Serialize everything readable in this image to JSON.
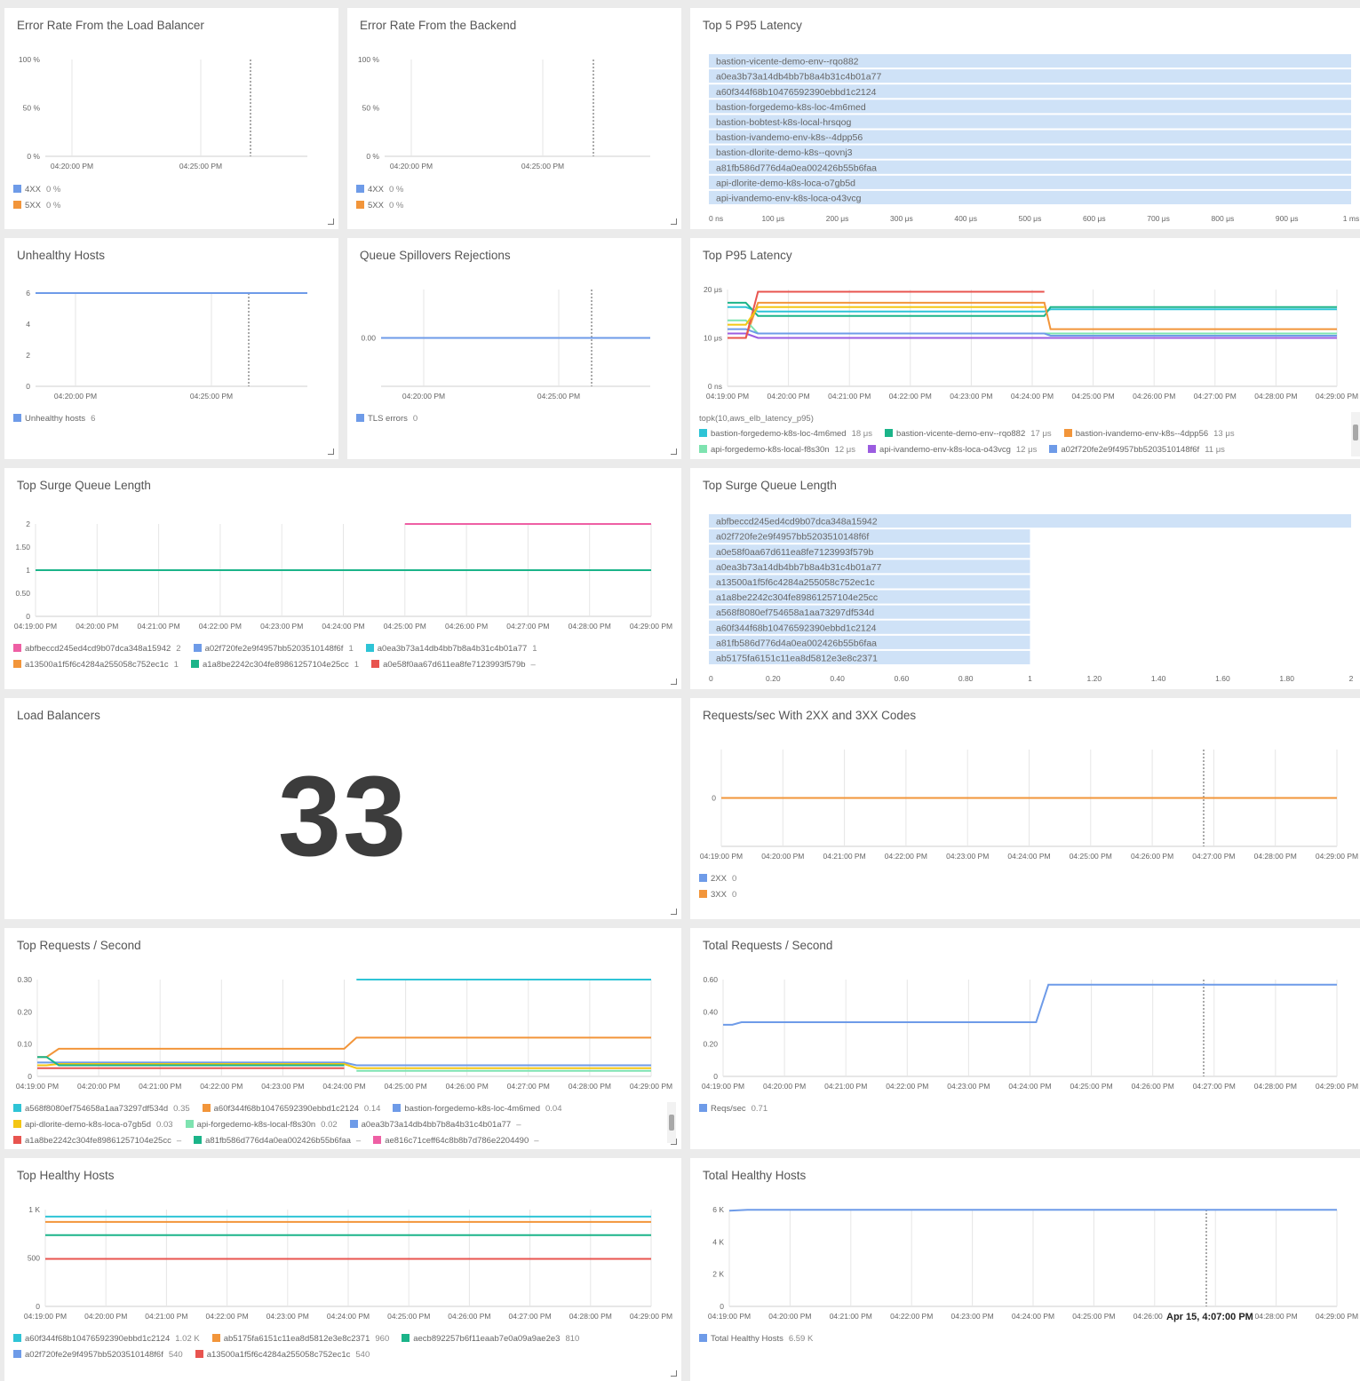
{
  "panels": {
    "p1": {
      "title": "Error Rate From the Load Balancer"
    },
    "p2": {
      "title": "Error Rate From the Backend"
    },
    "p3": {
      "title": "Top 5 P95 Latency"
    },
    "p4": {
      "title": "Unhealthy Hosts"
    },
    "p5": {
      "title": "Queue Spillovers Rejections"
    },
    "p6": {
      "title": "Top P95 Latency",
      "query": "topk(10,aws_elb_latency_p95)"
    },
    "p7": {
      "title": "Top Surge Queue Length"
    },
    "p8": {
      "title": "Top Surge Queue Length"
    },
    "p9": {
      "title": "Load Balancers",
      "value": "33"
    },
    "p10": {
      "title": "Requests/sec With 2XX and 3XX Codes"
    },
    "p11": {
      "title": "Top Requests / Second"
    },
    "p12": {
      "title": "Total Requests / Second"
    },
    "p13": {
      "title": "Top Healthy Hosts"
    },
    "p14": {
      "title": "Total Healthy Hosts",
      "tooltip": "Apr 15, 4:07:00 PM"
    }
  },
  "colors": {
    "blue": "#6e9be8",
    "orange": "#f2953a",
    "teal": "#2ec4d6",
    "green": "#1bb489",
    "red": "#e8544f",
    "purple": "#9b5ce0",
    "pink": "#ee5fa4",
    "lightgreen": "#7ee3b0",
    "yellow": "#f3c614",
    "grid": "#e6e6e6",
    "bar": "#cfe2f7"
  },
  "chart_data": [
    {
      "id": "p1",
      "type": "line",
      "ytick_labels": [
        "100 %",
        "50 %",
        "0 %"
      ],
      "xtick_labels": [
        "04:20:00 PM",
        "04:25:00 PM"
      ],
      "series": [
        {
          "name": "4XX",
          "color": "#6e9be8",
          "value": "0 %",
          "legend_value": "0 %"
        },
        {
          "name": "5XX",
          "color": "#f2953a",
          "value": "0 %",
          "legend_value": "0 %"
        }
      ]
    },
    {
      "id": "p2",
      "type": "line",
      "ytick_labels": [
        "100 %",
        "50 %",
        "0 %"
      ],
      "xtick_labels": [
        "04:20:00 PM",
        "04:25:00 PM"
      ],
      "series": [
        {
          "name": "4XX",
          "color": "#6e9be8",
          "legend_value": "0 %"
        },
        {
          "name": "5XX",
          "color": "#f2953a",
          "legend_value": "0 %"
        }
      ]
    },
    {
      "id": "p3",
      "type": "bar",
      "orientation": "horizontal",
      "unit": "μs",
      "categories": [
        "bastion-vicente-demo-env--rqo882",
        "a0ea3b73a14db4bb7b8a4b31c4b01a77",
        "a60f344f68b10476592390ebbd1c2124",
        "bastion-forgedemo-k8s-loc-4m6med",
        "bastion-bobtest-k8s-local-hrsqog",
        "bastion-ivandemo-env-k8s--4dpp56",
        "bastion-dlorite-demo-k8s--qovnj3",
        "a81fb586d776d4a0ea002426b55b6faa",
        "api-dlorite-demo-k8s-loca-o7gb5d",
        "api-ivandemo-env-k8s-loca-o43vcg"
      ],
      "values": [
        1000,
        1000,
        1000,
        1000,
        1000,
        1000,
        1000,
        1000,
        1000,
        1000
      ],
      "xlim": [
        0,
        1000
      ],
      "xtick_labels": [
        "0 ns",
        "100 μs",
        "200 μs",
        "300 μs",
        "400 μs",
        "500 μs",
        "600 μs",
        "700 μs",
        "800 μs",
        "900 μs",
        "1 ms"
      ]
    },
    {
      "id": "p4",
      "type": "line",
      "ylim": [
        0,
        6
      ],
      "ytick_labels": [
        "6",
        "4",
        "2",
        "0"
      ],
      "xtick_labels": [
        "04:20:00 PM",
        "04:25:00 PM"
      ],
      "series": [
        {
          "name": "Unhealthy hosts",
          "color": "#6e9be8",
          "values": [
            6,
            6
          ],
          "legend_value": "6"
        }
      ]
    },
    {
      "id": "p5",
      "type": "line",
      "ytick_labels": [
        "0.00"
      ],
      "xtick_labels": [
        "04:20:00 PM",
        "04:25:00 PM"
      ],
      "series": [
        {
          "name": "TLS errors",
          "color": "#6e9be8",
          "values": [
            0,
            0
          ],
          "legend_value": "0"
        }
      ]
    },
    {
      "id": "p6",
      "type": "line",
      "unit": "μs",
      "ylim": [
        0,
        22
      ],
      "ytick_labels": [
        "20 μs",
        "10 μs",
        "0 ns"
      ],
      "xtick_labels": [
        "04:19:00 PM",
        "04:20:00 PM",
        "04:21:00 PM",
        "04:22:00 PM",
        "04:23:00 PM",
        "04:24:00 PM",
        "04:25:00 PM",
        "04:26:00 PM",
        "04:27:00 PM",
        "04:28:00 PM",
        "04:29:00 PM"
      ],
      "x": [
        0,
        0.3,
        0.5,
        5.2,
        5.3,
        10
      ],
      "series": [
        {
          "name": "bastion-forgedemo-k8s-loc-4m6med",
          "color": "#2ec4d6",
          "legend_value": "18 μs",
          "values": [
            18,
            18,
            17,
            17,
            17.5,
            17.5
          ]
        },
        {
          "name": "bastion-vicente-demo-env--rqo882",
          "color": "#1bb489",
          "legend_value": "17 μs",
          "values": [
            19,
            19,
            16,
            16,
            18,
            18
          ]
        },
        {
          "name": "bastion-ivandemo-env-k8s--4dpp56",
          "color": "#f2953a",
          "legend_value": "13 μs",
          "values": [
            11,
            11,
            19,
            19,
            13,
            13
          ]
        },
        {
          "name": "api-forgedemo-k8s-local-f8s30n",
          "color": "#7ee3b0",
          "legend_value": "12 μs",
          "values": [
            15,
            15,
            12,
            12,
            12,
            12
          ]
        },
        {
          "name": "api-ivandemo-env-k8s-loca-o43vcg",
          "color": "#9b5ce0",
          "legend_value": "12 μs",
          "values": [
            12,
            12,
            11,
            11,
            11,
            11
          ]
        },
        {
          "name": "a02f720fe2e9f4957bb5203510148f6f",
          "color": "#6e9be8",
          "legend_value": "11 μs",
          "values": [
            13,
            13,
            12,
            12,
            11.5,
            11.5
          ]
        },
        {
          "name": "",
          "color": "#e8544f",
          "values": [
            11,
            11,
            21.5,
            21.5,
            null,
            null
          ]
        },
        {
          "name": "",
          "color": "#f3c614",
          "values": [
            14,
            14,
            18,
            18,
            null,
            null
          ]
        }
      ]
    },
    {
      "id": "p7",
      "type": "line",
      "ylim": [
        0,
        2
      ],
      "ytick_labels": [
        "2",
        "1.50",
        "1",
        "0.50",
        "0"
      ],
      "xtick_labels": [
        "04:19:00 PM",
        "04:20:00 PM",
        "04:21:00 PM",
        "04:22:00 PM",
        "04:23:00 PM",
        "04:24:00 PM",
        "04:25:00 PM",
        "04:26:00 PM",
        "04:27:00 PM",
        "04:28:00 PM",
        "04:29:00 PM"
      ],
      "series": [
        {
          "name": "abfbeccd245ed4cd9b07dca348a15942",
          "color": "#ee5fa4",
          "legend_value": "2",
          "values": [
            null,
            null,
            null,
            null,
            null,
            null,
            2,
            2,
            2,
            2,
            2
          ]
        },
        {
          "name": "a02f720fe2e9f4957bb5203510148f6f",
          "color": "#6e9be8",
          "legend_value": "1",
          "values": [
            1,
            1,
            1,
            1,
            1,
            1,
            1,
            1,
            1,
            1,
            1
          ]
        },
        {
          "name": "a0ea3b73a14db4bb7b8a4b31c4b01a77",
          "color": "#2ec4d6",
          "legend_value": "1",
          "values": [
            1,
            1,
            1,
            1,
            1,
            1,
            1,
            1,
            1,
            1,
            1
          ]
        },
        {
          "name": "a13500a1f5f6c4284a255058c752ec1c",
          "color": "#f2953a",
          "legend_value": "1",
          "values": [
            1,
            1,
            1,
            1,
            1,
            1,
            1,
            1,
            1,
            1,
            1
          ]
        },
        {
          "name": "a1a8be2242c304fe89861257104e25cc",
          "color": "#1bb489",
          "legend_value": "1",
          "values": [
            1,
            1,
            1,
            1,
            1,
            1,
            1,
            1,
            1,
            1,
            1
          ]
        },
        {
          "name": "a0e58f0aa67d611ea8fe7123993f579b",
          "color": "#e8544f",
          "legend_value": "–"
        }
      ]
    },
    {
      "id": "p8",
      "type": "bar",
      "orientation": "horizontal",
      "categories": [
        "abfbeccd245ed4cd9b07dca348a15942",
        "a02f720fe2e9f4957bb5203510148f6f",
        "a0e58f0aa67d611ea8fe7123993f579b",
        "a0ea3b73a14db4bb7b8a4b31c4b01a77",
        "a13500a1f5f6c4284a255058c752ec1c",
        "a1a8be2242c304fe89861257104e25cc",
        "a568f8080ef754658a1aa73297df534d",
        "a60f344f68b10476592390ebbd1c2124",
        "a81fb586d776d4a0ea002426b55b6faa",
        "ab5175fa6151c11ea8d5812e3e8c2371"
      ],
      "values": [
        2,
        1,
        1,
        1,
        1,
        1,
        1,
        1,
        1,
        1
      ],
      "xlim": [
        0,
        2
      ],
      "xtick_labels": [
        "0",
        "0.20",
        "0.40",
        "0.60",
        "0.80",
        "1",
        "1.20",
        "1.40",
        "1.60",
        "1.80",
        "2"
      ]
    },
    {
      "id": "p10",
      "type": "line",
      "ytick_labels": [
        "0"
      ],
      "xtick_labels": [
        "04:19:00 PM",
        "04:20:00 PM",
        "04:21:00 PM",
        "04:22:00 PM",
        "04:23:00 PM",
        "04:24:00 PM",
        "04:25:00 PM",
        "04:26:00 PM",
        "04:27:00 PM",
        "04:28:00 PM",
        "04:29:00 PM"
      ],
      "series": [
        {
          "name": "2XX",
          "color": "#6e9be8",
          "legend_value": "0",
          "values": [
            0,
            0
          ]
        },
        {
          "name": "3XX",
          "color": "#f2953a",
          "legend_value": "0",
          "values": [
            0,
            0
          ]
        }
      ]
    },
    {
      "id": "p11",
      "type": "line",
      "ylim": [
        0,
        0.35
      ],
      "ytick_labels": [
        "0.30",
        "0.20",
        "0.10",
        "0"
      ],
      "xtick_labels": [
        "04:19:00 PM",
        "04:20:00 PM",
        "04:21:00 PM",
        "04:22:00 PM",
        "04:23:00 PM",
        "04:24:00 PM",
        "04:25:00 PM",
        "04:26:00 PM",
        "04:27:00 PM",
        "04:28:00 PM",
        "04:29:00 PM"
      ],
      "x": [
        0,
        0.15,
        0.35,
        5.0,
        5.2,
        10
      ],
      "series": [
        {
          "name": "a568f8080ef754658a1aa73297df534d",
          "color": "#2ec4d6",
          "legend_value": "0.35",
          "values": [
            null,
            null,
            null,
            null,
            0.35,
            0.35
          ]
        },
        {
          "name": "a60f344f68b10476592390ebbd1c2124",
          "color": "#f2953a",
          "legend_value": "0.14",
          "values": [
            0.07,
            0.07,
            0.1,
            0.1,
            0.14,
            0.14
          ]
        },
        {
          "name": "bastion-forgedemo-k8s-loc-4m6med",
          "color": "#6e9be8",
          "legend_value": "0.04",
          "values": [
            0.05,
            0.05,
            0.05,
            0.05,
            0.04,
            0.04
          ]
        },
        {
          "name": "api-dlorite-demo-k8s-loca-o7gb5d",
          "color": "#f3c614",
          "legend_value": "0.03",
          "values": [
            0.04,
            0.04,
            0.045,
            0.045,
            0.03,
            0.03
          ]
        },
        {
          "name": "api-forgedemo-k8s-local-f8s30n",
          "color": "#7ee3b0",
          "legend_value": "0.02",
          "values": [
            null,
            null,
            null,
            null,
            0.02,
            0.02
          ]
        },
        {
          "name": "a0ea3b73a14db4bb7b8a4b31c4b01a77",
          "color": "#6e9be8",
          "legend_value": "–"
        },
        {
          "name": "a1a8be2242c304fe89861257104e25cc",
          "color": "#e8544f",
          "legend_value": "–",
          "values": [
            0.03,
            0.03,
            0.03,
            0.03,
            null,
            null
          ]
        },
        {
          "name": "a81fb586d776d4a0ea002426b55b6faa",
          "color": "#1bb489",
          "legend_value": "–",
          "values": [
            0.07,
            0.07,
            0.04,
            0.04,
            null,
            null
          ]
        },
        {
          "name": "ae816c71ceff64c8b8b7d786e2204490",
          "color": "#ee5fa4",
          "legend_value": "–"
        }
      ]
    },
    {
      "id": "p12",
      "type": "line",
      "ylim": [
        0,
        0.75
      ],
      "ytick_labels": [
        "0.60",
        "0.40",
        "0.20",
        "0"
      ],
      "xtick_labels": [
        "04:19:00 PM",
        "04:20:00 PM",
        "04:21:00 PM",
        "04:22:00 PM",
        "04:23:00 PM",
        "04:24:00 PM",
        "04:25:00 PM",
        "04:26:00 PM",
        "04:27:00 PM",
        "04:28:00 PM",
        "04:29:00 PM"
      ],
      "x": [
        0,
        0.15,
        0.3,
        5.1,
        5.3,
        10
      ],
      "series": [
        {
          "name": "Reqs/sec",
          "color": "#6e9be8",
          "legend_value": "0.71",
          "values": [
            0.4,
            0.4,
            0.42,
            0.42,
            0.71,
            0.71
          ]
        }
      ]
    },
    {
      "id": "p13",
      "type": "line",
      "ylim": [
        0,
        1100
      ],
      "ytick_labels": [
        "1 K",
        "500",
        "0"
      ],
      "xtick_labels": [
        "04:19:00 PM",
        "04:20:00 PM",
        "04:21:00 PM",
        "04:22:00 PM",
        "04:23:00 PM",
        "04:24:00 PM",
        "04:25:00 PM",
        "04:26:00 PM",
        "04:27:00 PM",
        "04:28:00 PM",
        "04:29:00 PM"
      ],
      "series": [
        {
          "name": "a60f344f68b10476592390ebbd1c2124",
          "color": "#2ec4d6",
          "legend_value": "1.02 K",
          "values": [
            1020,
            1020
          ]
        },
        {
          "name": "ab5175fa6151c11ea8d5812e3e8c2371",
          "color": "#f2953a",
          "legend_value": "960",
          "values": [
            960,
            960
          ]
        },
        {
          "name": "aecb892257b6f11eaab7e0a09a9ae2e3",
          "color": "#1bb489",
          "legend_value": "810",
          "values": [
            810,
            810
          ]
        },
        {
          "name": "a02f720fe2e9f4957bb5203510148f6f",
          "color": "#6e9be8",
          "legend_value": "540",
          "values": [
            540,
            540
          ]
        },
        {
          "name": "a13500a1f5f6c4284a255058c752ec1c",
          "color": "#e8544f",
          "legend_value": "540",
          "values": [
            540,
            540
          ]
        }
      ]
    },
    {
      "id": "p14",
      "type": "line",
      "ylim": [
        0,
        6600
      ],
      "ytick_labels": [
        "6 K",
        "4 K",
        "2 K",
        "0"
      ],
      "xtick_labels": [
        "04:19:00 PM",
        "04:20:00 PM",
        "04:21:00 PM",
        "04:22:00 PM",
        "04:23:00 PM",
        "04:24:00 PM",
        "04:25:00 PM",
        "04:26:00 PM",
        "04:27:00 PM",
        "04:28:00 PM",
        "04:29:00 PM"
      ],
      "x": [
        0,
        0.3,
        10
      ],
      "series": [
        {
          "name": "Total Healthy Hosts",
          "color": "#6e9be8",
          "legend_value": "6.59 K",
          "values": [
            6530,
            6590,
            6590
          ]
        }
      ]
    }
  ]
}
